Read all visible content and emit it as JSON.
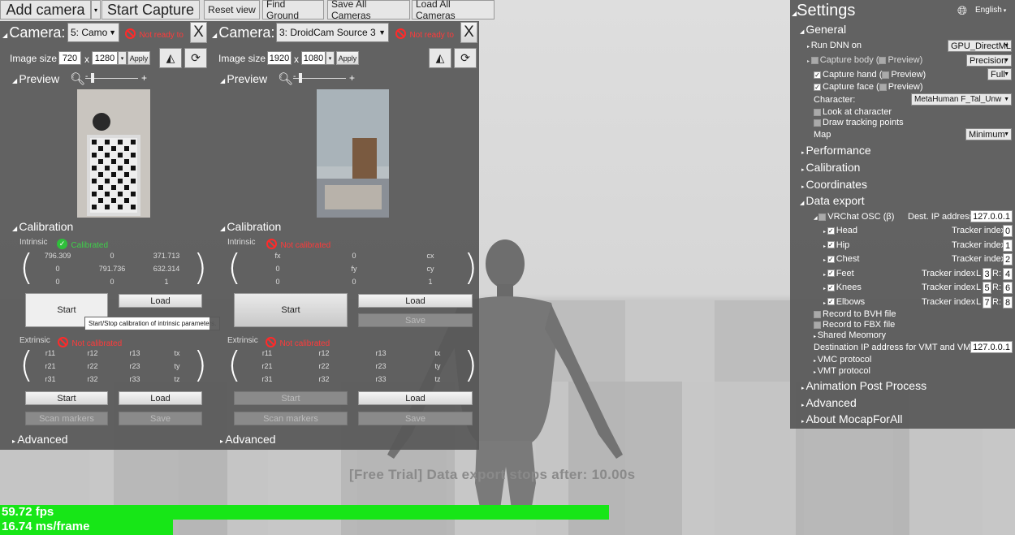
{
  "toolbar": {
    "add_camera": "Add camera",
    "start_capture": "Start Capture",
    "reset_view": "Reset view",
    "find_ground": "Find Ground",
    "save_all": "Save All Cameras",
    "load_all": "Load All Cameras"
  },
  "cam1": {
    "label": "Camera:",
    "source": "5: Camo",
    "status": "Not ready to",
    "close": "X",
    "image_size_label": "Image size",
    "w": "720",
    "x": "x",
    "h": "1280",
    "apply": "Apply",
    "preview": "Preview",
    "calibration": "Calibration",
    "intrinsic": "Intrinsic",
    "intrinsic_status": "Calibrated",
    "m": [
      "796.309",
      "0",
      "371.713",
      "0",
      "791.736",
      "632.314",
      "0",
      "0",
      "1"
    ],
    "start": "Start",
    "load": "Load",
    "tooltip": "Start/Stop calibration of intrinsic parameters.",
    "extrinsic": "Extrinsic",
    "extrinsic_status": "Not calibrated",
    "e": [
      "r11",
      "r12",
      "r13",
      "tx",
      "r21",
      "r22",
      "r23",
      "ty",
      "r31",
      "r32",
      "r33",
      "tz"
    ],
    "estart": "Start",
    "eload": "Load",
    "scan": "Scan markers",
    "save": "Save",
    "advanced": "Advanced"
  },
  "cam2": {
    "label": "Camera:",
    "source": "3: DroidCam Source 3",
    "status": "Not ready to",
    "close": "X",
    "image_size_label": "Image size",
    "w": "1920",
    "x": "x",
    "h": "1080",
    "apply": "Apply",
    "preview": "Preview",
    "calibration": "Calibration",
    "intrinsic": "Intrinsic",
    "intrinsic_status": "Not calibrated",
    "m": [
      "fx",
      "0",
      "cx",
      "0",
      "fy",
      "cy",
      "0",
      "0",
      "1"
    ],
    "start": "Start",
    "load": "Load",
    "save": "Save",
    "extrinsic": "Extrinsic",
    "extrinsic_status": "Not calibrated",
    "e": [
      "r11",
      "r12",
      "r13",
      "tx",
      "r21",
      "r22",
      "r23",
      "ty",
      "r31",
      "r32",
      "r33",
      "tz"
    ],
    "estart": "Start",
    "eload": "Load",
    "scan": "Scan markers",
    "esave": "Save",
    "advanced": "Advanced"
  },
  "settings": {
    "title": "Settings",
    "language": "English",
    "general": "General",
    "run_dnn": "Run DNN on",
    "dnn_value": "GPU_DirectML",
    "capture_body": "Capture body (",
    "preview": "Preview)",
    "precision": "Precision",
    "capture_hand": "Capture hand (",
    "full": "Full",
    "capture_face": "Capture face (",
    "character": "Character:",
    "character_value": "MetaHuman F_Tal_Unw",
    "look_at": "Look at character",
    "draw_points": "Draw tracking points",
    "map": "Map",
    "map_value": "Minimum",
    "performance": "Performance",
    "calibration": "Calibration",
    "coordinates": "Coordinates",
    "data_export": "Data export",
    "vrchat": "VRChat OSC (β)",
    "dest_ip": "Dest. IP address",
    "ip": "127.0.0.1",
    "trackers": [
      {
        "name": "Head",
        "label": "Tracker index",
        "vals": [
          "0"
        ]
      },
      {
        "name": "Hip",
        "label": "Tracker index",
        "vals": [
          "1"
        ]
      },
      {
        "name": "Chest",
        "label": "Tracker index",
        "vals": [
          "2"
        ]
      },
      {
        "name": "Feet",
        "label": "Tracker index",
        "vals": [
          "3",
          "4"
        ]
      },
      {
        "name": "Knees",
        "label": "Tracker index",
        "vals": [
          "5",
          "6"
        ]
      },
      {
        "name": "Elbows",
        "label": "Tracker index",
        "vals": [
          "7",
          "8"
        ]
      }
    ],
    "L": "L",
    "R": "R:",
    "bvh": "Record to BVH file",
    "fbx": "Record to FBX file",
    "shared": "Shared Meomory",
    "vmt_ip_label": "Destination IP address for VMT and VMC",
    "vmt_ip": "127.0.0.1",
    "vmc": "VMC protocol",
    "vmt": "VMT protocol",
    "anim_post": "Animation Post Process",
    "advanced": "Advanced",
    "about": "About MocapForAll"
  },
  "overlay": {
    "trial": "[Free Trial] Data export stops after: 10.00s",
    "fps": "59.72 fps",
    "ms": "16.74 ms/frame",
    "fps_fill": 0.6,
    "ms_fill": 0.17
  }
}
